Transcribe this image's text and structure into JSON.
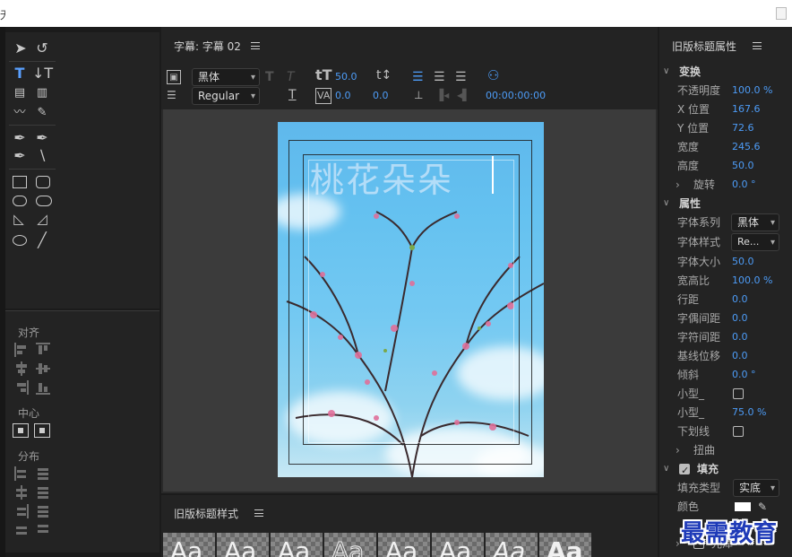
{
  "window": {
    "title_fragment": "无"
  },
  "editor": {
    "tab_title": "字幕: 字幕 02",
    "font_family": "黑体",
    "font_style": "Regular",
    "font_size": "50.0",
    "kerning": "0.0",
    "leading": "0.0",
    "timecode": "00:00:00:00",
    "title_text": "桃花朵朵"
  },
  "tools_panel": {
    "align_label": "对齐",
    "center_label": "中心",
    "distribute_label": "分布"
  },
  "styles_panel": {
    "title": "旧版标题样式",
    "swatch_text": "Aa",
    "swatch_count": 8
  },
  "properties": {
    "title": "旧版标题属性",
    "transform": {
      "header": "变换",
      "rows": [
        {
          "label": "不透明度",
          "value": "100.0 %"
        },
        {
          "label": "X 位置",
          "value": "167.6"
        },
        {
          "label": "Y 位置",
          "value": "72.6"
        },
        {
          "label": "宽度",
          "value": "245.6"
        },
        {
          "label": "高度",
          "value": "50.0"
        }
      ],
      "rotation": {
        "label": "旋转",
        "value": "0.0 °"
      }
    },
    "attributes": {
      "header": "属性",
      "font_family_label": "字体系列",
      "font_family_value": "黑体",
      "font_style_label": "字体样式",
      "font_style_value": "Re...",
      "rows": [
        {
          "label": "字体大小",
          "value": "50.0"
        },
        {
          "label": "宽高比",
          "value": "100.0 %"
        },
        {
          "label": "行距",
          "value": "0.0"
        },
        {
          "label": "字偶间距",
          "value": "0.0"
        },
        {
          "label": "字符间距",
          "value": "0.0"
        },
        {
          "label": "基线位移",
          "value": "0.0"
        },
        {
          "label": "倾斜",
          "value": "0.0 °"
        }
      ],
      "small_caps_label": "小型_",
      "small_caps_size_label": "小型_",
      "small_caps_size_value": "75.0 %",
      "underline_label": "下划线",
      "distort_label": "扭曲"
    },
    "fill": {
      "header": "填充",
      "fill_type_label": "填充类型",
      "fill_type_value": "实底",
      "color_label": "颜色",
      "color_value": "#ffffff",
      "sheen_label": "光泽"
    }
  },
  "watermark": "最需教育",
  "colors": {
    "accent": "#4d9cf7",
    "panel": "#232323",
    "canvas_bg": "#3b3b3b"
  }
}
